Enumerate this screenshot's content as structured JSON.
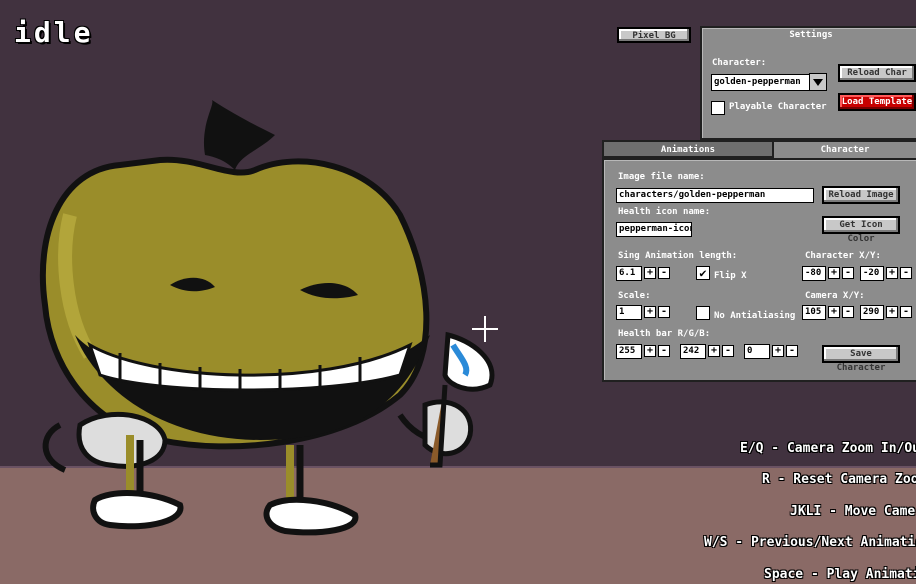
{
  "animation_name": "idle",
  "toolbar": {
    "pixel_bg_label": "Pixel BG"
  },
  "settings": {
    "title": "Settings",
    "character_label": "Character:",
    "character_value": "golden-pepperman",
    "reload_char_label": "Reload Char",
    "load_template_label": "Load Template",
    "playable_label": "Playable Character",
    "playable_checked": false
  },
  "tabs": [
    {
      "label": "Animations",
      "active": false
    },
    {
      "label": "Character",
      "active": true
    }
  ],
  "character_panel": {
    "image_label": "Image file name:",
    "image_value": "characters/golden-pepperman",
    "reload_image_label": "Reload Image",
    "health_icon_label": "Health icon name:",
    "health_icon_value": "pepperman-icon",
    "get_icon_color_label": "Get Icon Color",
    "sing_label": "Sing Animation length:",
    "sing_value": "6.1",
    "flip_x_label": "Flip X",
    "flip_x_checked": true,
    "char_xy_label": "Character X/Y:",
    "char_x": "-80",
    "char_y": "-20",
    "scale_label": "Scale:",
    "scale_value": "1",
    "no_antialias_label": "No Antialiasing",
    "no_antialias_checked": false,
    "camera_xy_label": "Camera X/Y:",
    "camera_x": "105",
    "camera_y": "290",
    "health_bar_label": "Health bar R/G/B:",
    "health_r": "255",
    "health_g": "242",
    "health_b": "0",
    "save_label": "Save Character"
  },
  "hints": [
    "E/Q - Camera Zoom In/Out",
    "R - Reset Camera Zoom",
    "JKLI - Move Camera",
    "W/S - Previous/Next Animation",
    "Space - Play Animation"
  ],
  "stepper": {
    "plus": "+",
    "minus": "-"
  },
  "check_mark": "✔",
  "colors": {
    "wall": "#41323f",
    "floor": "#8a6a66",
    "panel": "#8c8c8c",
    "red_button": "#c80000"
  }
}
